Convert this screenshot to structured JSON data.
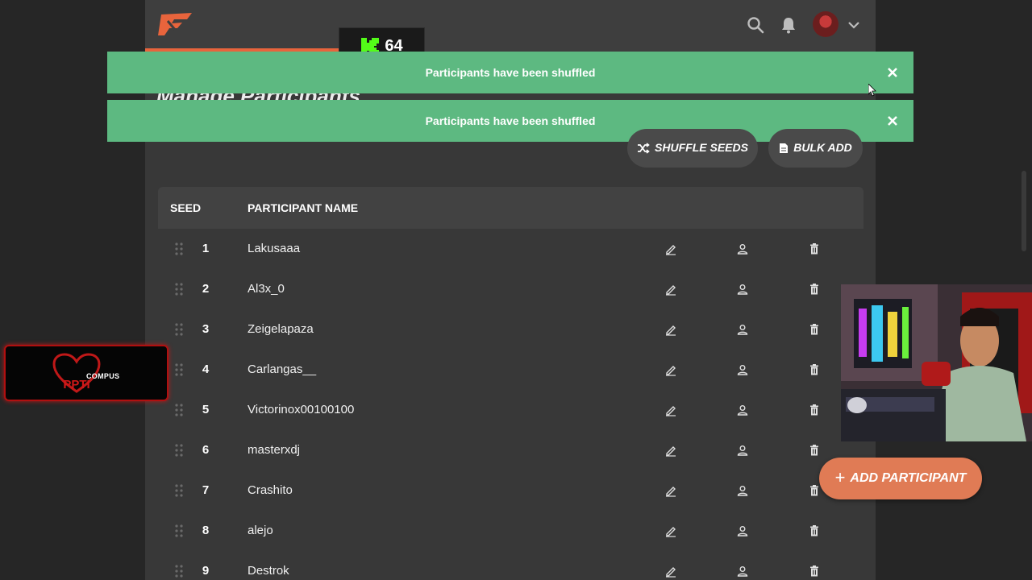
{
  "header": {
    "kick_count": "64",
    "page_title": "Manage Participants"
  },
  "toasts": [
    {
      "message": "Participants have been shuffled"
    },
    {
      "message": "Participants have been shuffled"
    }
  ],
  "actions": {
    "shuffle_label": "SHUFFLE SEEDS",
    "bulk_add_label": "BULK ADD",
    "add_participant_label": "ADD PARTICIPANT"
  },
  "table": {
    "columns": [
      "SEED",
      "PARTICIPANT NAME"
    ],
    "rows": [
      {
        "seed": "1",
        "name": "Lakusaaa"
      },
      {
        "seed": "2",
        "name": "Al3x_0"
      },
      {
        "seed": "3",
        "name": "Zeigelapaza"
      },
      {
        "seed": "4",
        "name": "Carlangas__"
      },
      {
        "seed": "5",
        "name": "Victorinox00100100"
      },
      {
        "seed": "6",
        "name": "masterxdj"
      },
      {
        "seed": "7",
        "name": "Crashito"
      },
      {
        "seed": "8",
        "name": "alejo"
      },
      {
        "seed": "9",
        "name": "Destrok"
      }
    ]
  },
  "overlay": {
    "compus_label": "COMPUS"
  },
  "colors": {
    "accent": "#e07b55",
    "toast_bg": "#5db981",
    "panel_bg": "#383838",
    "kick_green": "#53fc18"
  }
}
